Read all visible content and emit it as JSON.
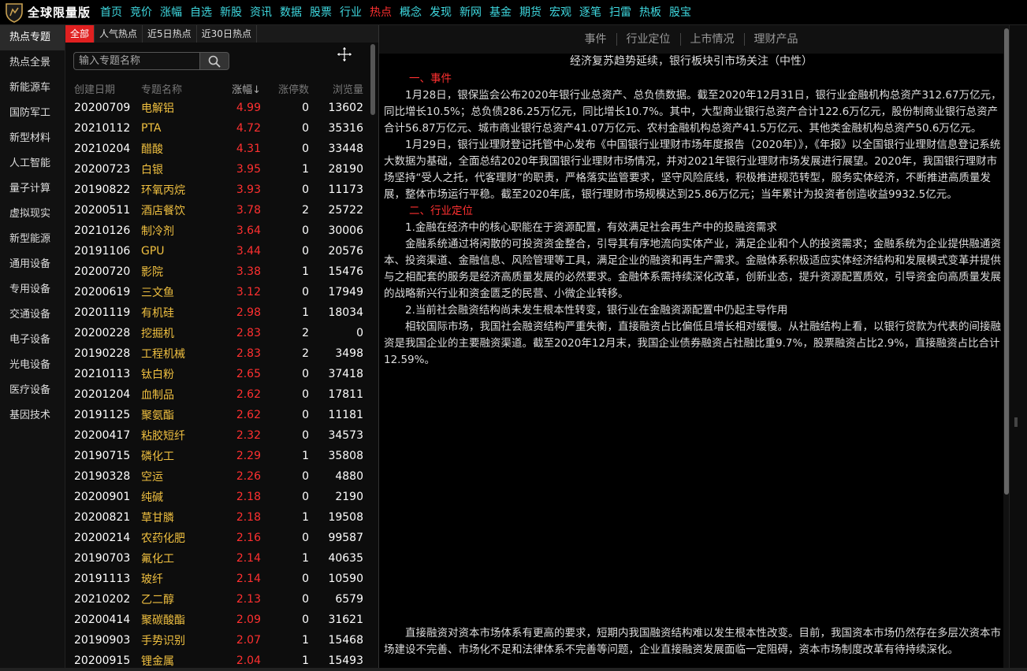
{
  "app": {
    "title": "全球限量版"
  },
  "nav": [
    {
      "label": "首页"
    },
    {
      "label": "竞价"
    },
    {
      "label": "涨幅"
    },
    {
      "label": "自选"
    },
    {
      "label": "新股"
    },
    {
      "label": "资讯"
    },
    {
      "label": "数据"
    },
    {
      "label": "股票"
    },
    {
      "label": "行业"
    },
    {
      "label": "热点",
      "active": true
    },
    {
      "label": "概念"
    },
    {
      "label": "发现"
    },
    {
      "label": "新网"
    },
    {
      "label": "基金"
    },
    {
      "label": "期货"
    },
    {
      "label": "宏观"
    },
    {
      "label": "逐笔"
    },
    {
      "label": "扫雷"
    },
    {
      "label": "热板"
    },
    {
      "label": "股宝"
    }
  ],
  "sidebar": [
    {
      "label": "热点专题",
      "active": true
    },
    {
      "label": "热点全景"
    },
    {
      "label": "新能源车"
    },
    {
      "label": "国防军工"
    },
    {
      "label": "新型材料"
    },
    {
      "label": "人工智能"
    },
    {
      "label": "量子计算"
    },
    {
      "label": "虚拟现实"
    },
    {
      "label": "新型能源"
    },
    {
      "label": "通用设备"
    },
    {
      "label": "专用设备"
    },
    {
      "label": "交通设备"
    },
    {
      "label": "电子设备"
    },
    {
      "label": "光电设备"
    },
    {
      "label": "医疗设备"
    },
    {
      "label": "基因技术"
    }
  ],
  "subtabs": [
    {
      "label": "全部",
      "active": true
    },
    {
      "label": "人气热点"
    },
    {
      "label": "近5日热点"
    },
    {
      "label": "近30日热点"
    }
  ],
  "search": {
    "placeholder": "输入专题名称"
  },
  "table": {
    "headers": {
      "date": "创建日期",
      "name": "专题名称",
      "change": "涨幅↓",
      "limit_up": "涨停数",
      "views": "浏览量"
    },
    "rows": [
      {
        "date": "20200709",
        "name": "电解铝",
        "change": "4.99",
        "limit_up": "0",
        "views": "13602"
      },
      {
        "date": "20210112",
        "name": "PTA",
        "change": "4.72",
        "limit_up": "0",
        "views": "35316"
      },
      {
        "date": "20210204",
        "name": "醋酸",
        "change": "4.31",
        "limit_up": "0",
        "views": "33448"
      },
      {
        "date": "20200723",
        "name": "白银",
        "change": "3.95",
        "limit_up": "1",
        "views": "28190"
      },
      {
        "date": "20190822",
        "name": "环氧丙烷",
        "change": "3.93",
        "limit_up": "0",
        "views": "11173"
      },
      {
        "date": "20200511",
        "name": "酒店餐饮",
        "change": "3.78",
        "limit_up": "2",
        "views": "25722"
      },
      {
        "date": "20210126",
        "name": "制冷剂",
        "change": "3.64",
        "limit_up": "0",
        "views": "30006"
      },
      {
        "date": "20191106",
        "name": "GPU",
        "change": "3.44",
        "limit_up": "0",
        "views": "20576"
      },
      {
        "date": "20200720",
        "name": "影院",
        "change": "3.38",
        "limit_up": "1",
        "views": "15476"
      },
      {
        "date": "20200619",
        "name": "三文鱼",
        "change": "3.12",
        "limit_up": "0",
        "views": "17949"
      },
      {
        "date": "20201119",
        "name": "有机硅",
        "change": "2.98",
        "limit_up": "1",
        "views": "18034"
      },
      {
        "date": "20200228",
        "name": "挖掘机",
        "change": "2.83",
        "limit_up": "2",
        "views": "0"
      },
      {
        "date": "20190228",
        "name": "工程机械",
        "change": "2.83",
        "limit_up": "2",
        "views": "3498"
      },
      {
        "date": "20210113",
        "name": "钛白粉",
        "change": "2.65",
        "limit_up": "0",
        "views": "37418"
      },
      {
        "date": "20201204",
        "name": "血制品",
        "change": "2.62",
        "limit_up": "0",
        "views": "17811"
      },
      {
        "date": "20191125",
        "name": "聚氨酯",
        "change": "2.62",
        "limit_up": "0",
        "views": "11181"
      },
      {
        "date": "20200417",
        "name": "粘胶短纤",
        "change": "2.32",
        "limit_up": "0",
        "views": "34573"
      },
      {
        "date": "20190715",
        "name": "磷化工",
        "change": "2.29",
        "limit_up": "1",
        "views": "35808"
      },
      {
        "date": "20190328",
        "name": "空运",
        "change": "2.26",
        "limit_up": "0",
        "views": "4880"
      },
      {
        "date": "20200901",
        "name": "纯碱",
        "change": "2.18",
        "limit_up": "0",
        "views": "2190"
      },
      {
        "date": "20200821",
        "name": "草甘膦",
        "change": "2.18",
        "limit_up": "1",
        "views": "19508"
      },
      {
        "date": "20200214",
        "name": "农药化肥",
        "change": "2.16",
        "limit_up": "0",
        "views": "99587"
      },
      {
        "date": "20190703",
        "name": "氟化工",
        "change": "2.14",
        "limit_up": "1",
        "views": "40635"
      },
      {
        "date": "20191113",
        "name": "玻纤",
        "change": "2.14",
        "limit_up": "0",
        "views": "10590"
      },
      {
        "date": "20210202",
        "name": "乙二醇",
        "change": "2.13",
        "limit_up": "0",
        "views": "6579"
      },
      {
        "date": "20200414",
        "name": "聚碳酸酯",
        "change": "2.09",
        "limit_up": "0",
        "views": "31621"
      },
      {
        "date": "20190903",
        "name": "手势识别",
        "change": "2.07",
        "limit_up": "1",
        "views": "15468"
      },
      {
        "date": "20200915",
        "name": "锂金属",
        "change": "2.04",
        "limit_up": "1",
        "views": "15493"
      }
    ]
  },
  "detail": {
    "tabs": [
      {
        "label": "事件"
      },
      {
        "label": "行业定位"
      },
      {
        "label": "上市情况"
      },
      {
        "label": "理财产品"
      }
    ],
    "title": "经济复苏趋势延续，银行板块引市场关注（中性）",
    "section1": "一、事件",
    "p1": "1月28日，银保监会公布2020年银行业总资产、总负债数据。截至2020年12月31日，银行业金融机构总资产312.67万亿元，同比增长10.5%；总负债286.25万亿元，同比增长10.7%。其中，大型商业银行总资产合计122.6万亿元，股份制商业银行总资产合计56.87万亿元、城市商业银行总资产41.07万亿元、农村金融机构总资产41.5万亿元、其他类金融机构总资产50.6万亿元。",
    "p2": "1月29日，银行业理财登记托管中心发布《中国银行业理财市场年度报告（2020年）》，《年报》以全国银行业理财信息登记系统大数据为基础，全面总结2020年我国银行业理财市场情况，并对2021年银行业理财市场发展进行展望。2020年，我国银行理财市场坚持“受人之托，代客理财”的职责，严格落实监管要求，坚守风险底线，积极推进规范转型，服务实体经济，不断推进高质量发展，整体市场运行平稳。截至2020年底，银行理财市场规模达到25.86万亿元；当年累计为投资者创造收益9932.5亿元。",
    "section2": "二、行业定位",
    "p3": "1.金融在经济中的核心职能在于资源配置，有效满足社会再生产中的投融资需求",
    "p4": "金融系统通过将闲散的可投资资金整合，引导其有序地流向实体产业，满足企业和个人的投资需求；金融系统为企业提供融通资本、投资渠道、金融信息、风险管理等工具，满足企业的融资和再生产需求。金融体系积极适应实体经济结构和发展模式变革并提供与之相配套的服务是经济高质量发展的必然要求。金融体系需持续深化改革，创新业态，提升资源配置质效，引导资金向高质量发展的战略新兴行业和资金匮乏的民营、小微企业转移。",
    "p5": "2.当前社会融资结构尚未发生根本性转变，银行业在金融资源配置中仍起主导作用",
    "p6": "相较国际市场，我国社会融资结构严重失衡，直接融资占比偏低且增长相对缓慢。从社融结构上看，以银行贷款为代表的间接融资是我国企业的主要融资渠道。截至2020年12月末，我国企业债券融资占社融比重9.7%，股票融资占比2.9%，直接融资占比合计12.59%。",
    "p7": "直接融资对资本市场体系有更高的要求，短期内我国融资结构难以发生根本性改变。目前，我国资本市场仍然存在多层次资本市场建设不完善、市场化不足和法律体系不完善等问题，企业直接融资发展面临一定阻碍，资本市场制度改革有待持续深化。"
  }
}
